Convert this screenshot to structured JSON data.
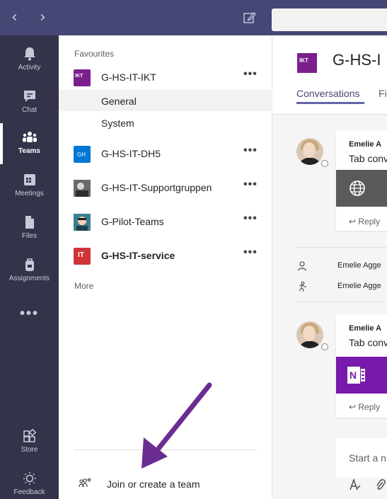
{
  "titlebar": {
    "back_glyph": "‹",
    "forward_glyph": "›",
    "compose_icon": "compose-icon"
  },
  "rail": {
    "items": [
      {
        "label": "Activity",
        "icon": "bell-icon"
      },
      {
        "label": "Chat",
        "icon": "chat-icon"
      },
      {
        "label": "Teams",
        "icon": "teams-icon",
        "active": true
      },
      {
        "label": "Meetings",
        "icon": "calendar-icon"
      },
      {
        "label": "Files",
        "icon": "file-icon"
      },
      {
        "label": "Assignments",
        "icon": "backpack-icon"
      }
    ],
    "more": "•••",
    "store": "Store",
    "feedback": "Feedback"
  },
  "teams": {
    "favourites_label": "Favourites",
    "more_label": "More",
    "list": [
      {
        "name": "G-HS-IT-IKT",
        "bold": false,
        "avatar_color": "#7a1f8c",
        "avatar_text": "IKT"
      },
      {
        "name": "G-HS-IT-DH5",
        "bold": false,
        "avatar_color": "#0078d4",
        "avatar_text": "GH"
      },
      {
        "name": "G-HS-IT-Supportgruppen",
        "bold": false,
        "avatar_color": "#555555",
        "avatar_text": ""
      },
      {
        "name": "G-Pilot-Teams",
        "bold": false,
        "avatar_color": "#2e6b7a",
        "avatar_text": ""
      },
      {
        "name": "G-HS-IT-service",
        "bold": true,
        "avatar_color": "#d13438",
        "avatar_text": "IT"
      }
    ],
    "channels": [
      {
        "name": "General",
        "selected": true
      },
      {
        "name": "System",
        "selected": false
      }
    ],
    "more_dots": "•••",
    "join_label": "Join or create a team"
  },
  "main": {
    "team_avatar_text": "IKT",
    "team_title": "G-HS-I",
    "tabs": {
      "conversations": "Conversations",
      "files": "Fi"
    },
    "posts": [
      {
        "author": "Emelie A",
        "text": "Tab conv",
        "reply": "↩ Reply",
        "card": "website"
      },
      {
        "author": "Emelie A",
        "text": "Tab conv",
        "reply": "↩ Reply",
        "card": "onenote"
      }
    ],
    "system_rows": [
      {
        "text": "Emelie Agge",
        "icon": "person-icon"
      },
      {
        "text": "Emelie Agge",
        "icon": "run-icon"
      }
    ],
    "compose_placeholder": "Start a n"
  },
  "colors": {
    "titlebar": "#464775",
    "rail": "#33344a",
    "accent": "#6264a7",
    "arrow": "#6a2c91"
  }
}
